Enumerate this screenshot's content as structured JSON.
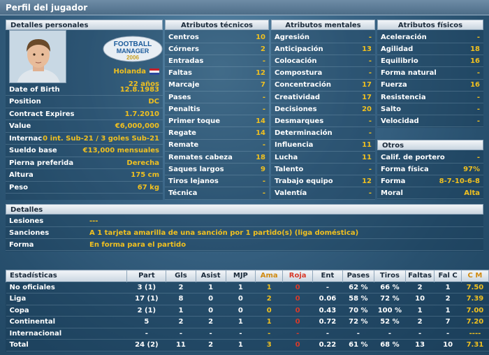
{
  "title": "Perfil del jugador",
  "personal": {
    "header": "Detalles personales",
    "nationality": "Holanda",
    "age": "22 años",
    "logo_line1": "FOOTBALL",
    "logo_line2": "MANAGER",
    "logo_line3": "2006",
    "rows": [
      {
        "label": "Date of Birth",
        "value": "12.8.1983"
      },
      {
        "label": "Position",
        "value": "DC"
      },
      {
        "label": "Contract Expires",
        "value": "1.7.2010"
      },
      {
        "label": "Value",
        "value": "€6,000,000"
      },
      {
        "label": "Internacional",
        "value": "0 int. Sub-21 / 3 goles Sub-21"
      },
      {
        "label": "Sueldo base",
        "value": "€13,000 mensuales"
      },
      {
        "label": "Pierna preferida",
        "value": "Derecha"
      },
      {
        "label": "Altura",
        "value": "175 cm"
      },
      {
        "label": "Peso",
        "value": "67 kg"
      }
    ]
  },
  "technical": {
    "header": "Atributos técnicos",
    "rows": [
      {
        "label": "Centros",
        "value": "10"
      },
      {
        "label": "Córners",
        "value": "2"
      },
      {
        "label": "Entradas",
        "value": "-"
      },
      {
        "label": "Faltas",
        "value": "12"
      },
      {
        "label": "Marcaje",
        "value": "7"
      },
      {
        "label": "Pases",
        "value": "-"
      },
      {
        "label": "Penaltis",
        "value": "-"
      },
      {
        "label": "Primer toque",
        "value": "14"
      },
      {
        "label": "Regate",
        "value": "14"
      },
      {
        "label": "Remate",
        "value": "-"
      },
      {
        "label": "Remates cabeza",
        "value": "18"
      },
      {
        "label": "Saques largos",
        "value": "9"
      },
      {
        "label": "Tiros lejanos",
        "value": "-"
      },
      {
        "label": "Técnica",
        "value": "-"
      }
    ]
  },
  "mental": {
    "header": "Atributos mentales",
    "rows": [
      {
        "label": "Agresión",
        "value": "-"
      },
      {
        "label": "Anticipación",
        "value": "13"
      },
      {
        "label": "Colocación",
        "value": "-"
      },
      {
        "label": "Compostura",
        "value": "-"
      },
      {
        "label": "Concentración",
        "value": "17"
      },
      {
        "label": "Creatividad",
        "value": "17"
      },
      {
        "label": "Decisiones",
        "value": "20"
      },
      {
        "label": "Desmarques",
        "value": "-"
      },
      {
        "label": "Determinación",
        "value": "-"
      },
      {
        "label": "Influencia",
        "value": "11"
      },
      {
        "label": "Lucha",
        "value": "11"
      },
      {
        "label": "Talento",
        "value": "-"
      },
      {
        "label": "Trabajo equipo",
        "value": "12"
      },
      {
        "label": "Valentía",
        "value": "-"
      }
    ]
  },
  "physical": {
    "header": "Atributos físicos",
    "rows": [
      {
        "label": "Aceleración",
        "value": "-"
      },
      {
        "label": "Agilidad",
        "value": "18"
      },
      {
        "label": "Equilibrio",
        "value": "16"
      },
      {
        "label": "Forma natural",
        "value": "-"
      },
      {
        "label": "Fuerza",
        "value": "16"
      },
      {
        "label": "Resistencia",
        "value": "-"
      },
      {
        "label": "Salto",
        "value": "-"
      },
      {
        "label": "Velocidad",
        "value": "-"
      }
    ]
  },
  "others": {
    "header": "Otros",
    "rows": [
      {
        "label": "Calif. de portero",
        "value": "-"
      },
      {
        "label": "Forma física",
        "value": "97%"
      },
      {
        "label": "Forma",
        "value": "8-7-10-6-8"
      },
      {
        "label": "Moral",
        "value": "Alta"
      }
    ]
  },
  "details": {
    "header": "Detalles",
    "rows": [
      {
        "label": "Lesiones",
        "value": "---"
      },
      {
        "label": "Sanciones",
        "value": "A 1 tarjeta amarilla de una sanción por 1 partido(s) (liga doméstica)"
      },
      {
        "label": "Forma",
        "value": "En forma para el partido"
      }
    ]
  },
  "stats": {
    "headers": [
      "Estadísticas",
      "Part",
      "Gls",
      "Asist",
      "MJP",
      "Ama",
      "Roja",
      "Ent",
      "Pases",
      "Tiros",
      "Faltas",
      "Fal C",
      "C M"
    ],
    "rows": [
      [
        "No oficiales",
        "3 (1)",
        "2",
        "1",
        "1",
        "1",
        "0",
        "-",
        "62 %",
        "66 %",
        "2",
        "1",
        "7.50"
      ],
      [
        "Liga",
        "17 (1)",
        "8",
        "0",
        "0",
        "2",
        "0",
        "0.06",
        "58 %",
        "72 %",
        "10",
        "2",
        "7.39"
      ],
      [
        "Copa",
        "2 (1)",
        "1",
        "0",
        "0",
        "0",
        "0",
        "0.43",
        "70 %",
        "100 %",
        "1",
        "1",
        "7.00"
      ],
      [
        "Continental",
        "5",
        "2",
        "2",
        "1",
        "1",
        "0",
        "0.72",
        "72 %",
        "52 %",
        "2",
        "7",
        "7.20"
      ],
      [
        "Internacional",
        "-",
        "-",
        "-",
        "-",
        "-",
        "-",
        "-",
        "-",
        "-",
        "-",
        "-",
        "----"
      ],
      [
        "Total",
        "24 (2)",
        "11",
        "2",
        "1",
        "3",
        "0",
        "0.22",
        "61 %",
        "68 %",
        "13",
        "10",
        "7.31"
      ]
    ]
  }
}
